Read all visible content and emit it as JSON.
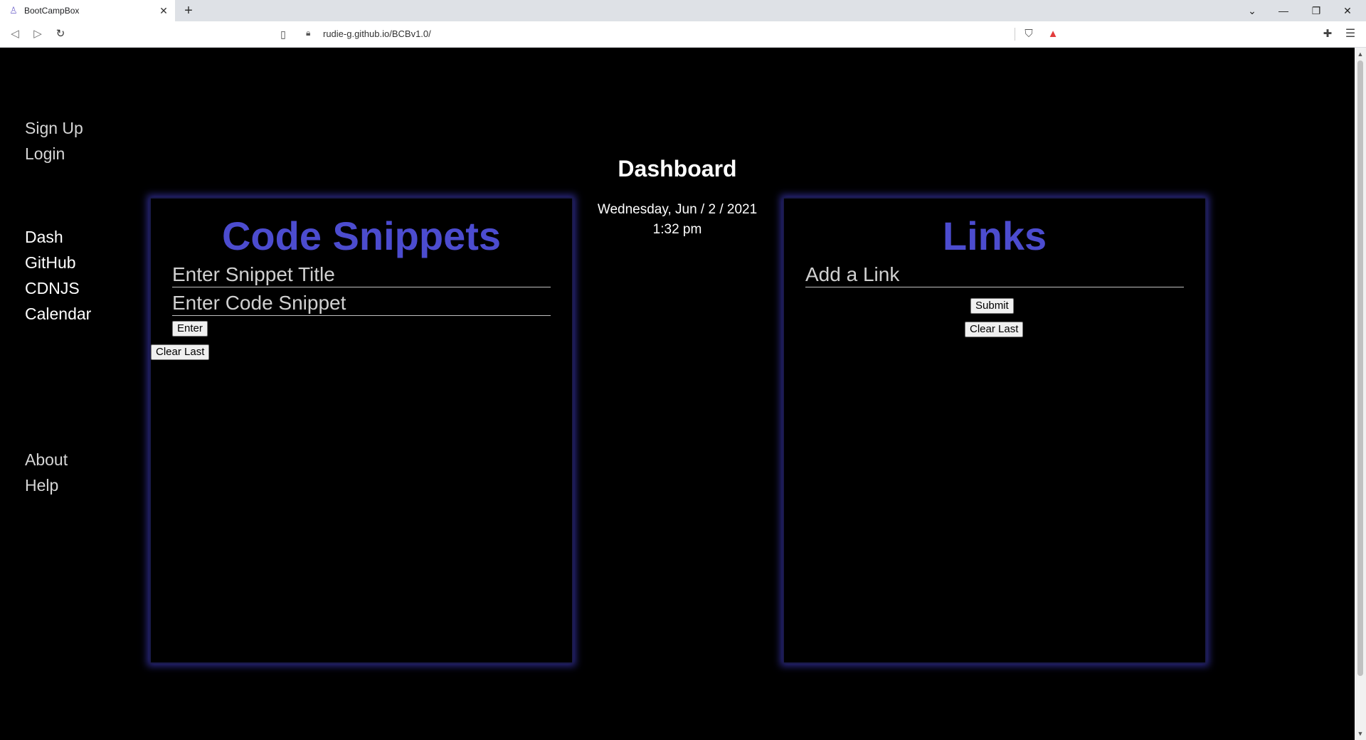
{
  "browser": {
    "tab_title": "BootCampBox",
    "url": "rudie-g.github.io/BCBv1.0/"
  },
  "sidebar": {
    "account": [
      {
        "label": "Sign Up"
      },
      {
        "label": "Login"
      }
    ],
    "main": [
      {
        "label": "Dash"
      },
      {
        "label": "GitHub"
      },
      {
        "label": "CDNJS"
      },
      {
        "label": "Calendar"
      }
    ],
    "footer": [
      {
        "label": "About"
      },
      {
        "label": "Help"
      }
    ]
  },
  "header": {
    "title": "Dashboard",
    "date": "Wednesday, Jun / 2 / 2021",
    "time": "1:32 pm"
  },
  "snippets": {
    "title": "Code Snippets",
    "title_placeholder": "Enter Snippet Title",
    "code_placeholder": "Enter Code Snippet",
    "enter_label": "Enter",
    "clear_label": "Clear Last"
  },
  "links": {
    "title": "Links",
    "link_placeholder": "Add a Link",
    "submit_label": "Submit",
    "clear_label": "Clear Last"
  },
  "colors": {
    "panel_title": "#4c4ccf",
    "panel_glow": "#2d2a8a",
    "background": "#000000"
  }
}
